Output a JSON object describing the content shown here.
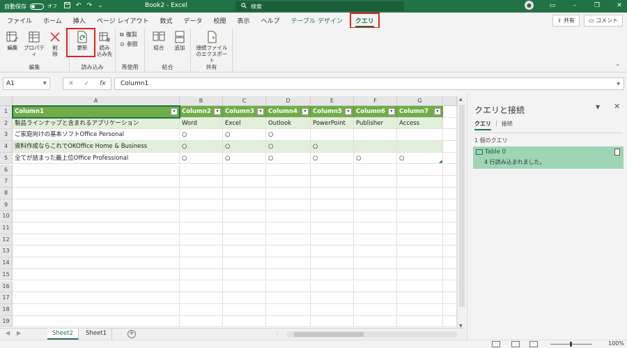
{
  "titlebar": {
    "autosave_label": "自動保存",
    "autosave_state": "オフ",
    "save_icon": "save-icon",
    "undo_icon": "undo-icon",
    "redo_icon": "redo-icon",
    "doc_title": "Book2 - Excel",
    "search_placeholder": "検索",
    "accent_color": "#217346"
  },
  "tabs": [
    "ファイル",
    "ホーム",
    "挿入",
    "ページ レイアウト",
    "数式",
    "データ",
    "校閲",
    "表示",
    "ヘルプ"
  ],
  "contextual_tab": "テーブル デザイン",
  "active_tab": "クエリ",
  "tab_actions": {
    "share": "共有",
    "comment": "コメント"
  },
  "ribbon": {
    "edit": {
      "label": "編集",
      "edit_btn": "編集",
      "props_btn": "プロパティ",
      "delete_btn_1": "削",
      "delete_btn_2": "除"
    },
    "load": {
      "label": "読み込み",
      "refresh_btn": "更新",
      "load_to_1": "読み",
      "load_to_2": "込み先"
    },
    "reuse": {
      "label": "再使用",
      "duplicate": "複製",
      "reference": "参照"
    },
    "combine": {
      "label": "結合",
      "merge": "結合",
      "append": "追加"
    },
    "share": {
      "label": "共有",
      "export_1": "接続ファイル",
      "export_2": "のエクスポート"
    }
  },
  "formula": {
    "namebox": "A1",
    "cancel_icon": "✕",
    "enter_icon": "✓",
    "fx": "fx",
    "content": "Column1"
  },
  "columns": [
    "A",
    "B",
    "C",
    "D",
    "E",
    "F",
    "G"
  ],
  "rows": [
    "1",
    "2",
    "3",
    "4",
    "5",
    "6",
    "7",
    "8",
    "9",
    "10",
    "11",
    "12",
    "13",
    "14",
    "15",
    "16",
    "17",
    "18",
    "19"
  ],
  "table": {
    "headers": [
      "Column1",
      "Column2",
      "Column3",
      "Column4",
      "Column5",
      "Column6",
      "Column7"
    ],
    "data": [
      [
        "製品ラインナップと含まれるアプリケーション",
        "Word",
        "Excel",
        "Outlook",
        "PowerPoint",
        "Publisher",
        "Access"
      ],
      [
        "ご家庭向けの基本ソフトOffice Personal",
        "○",
        "○",
        "○",
        "",
        "",
        ""
      ],
      [
        "資料作成ならこれでOKOffice Home & Business",
        "○",
        "○",
        "○",
        "○",
        "",
        ""
      ],
      [
        "全てが詰まった最上位Office Professional",
        "○",
        "○",
        "○",
        "○",
        "○",
        "○"
      ]
    ],
    "header_color": "#70ad47",
    "band_color": "#e2efda"
  },
  "sheets": [
    "Sheet2",
    "Sheet1"
  ],
  "active_sheet": "Sheet2",
  "zoom": "100%",
  "pane": {
    "title": "クエリと接続",
    "tab_queries": "クエリ",
    "tab_separator": "|",
    "tab_connections": "接続",
    "count": "1 個のクエリ",
    "query_name": "Table 0",
    "query_status": "4 行読み込まれました。"
  }
}
